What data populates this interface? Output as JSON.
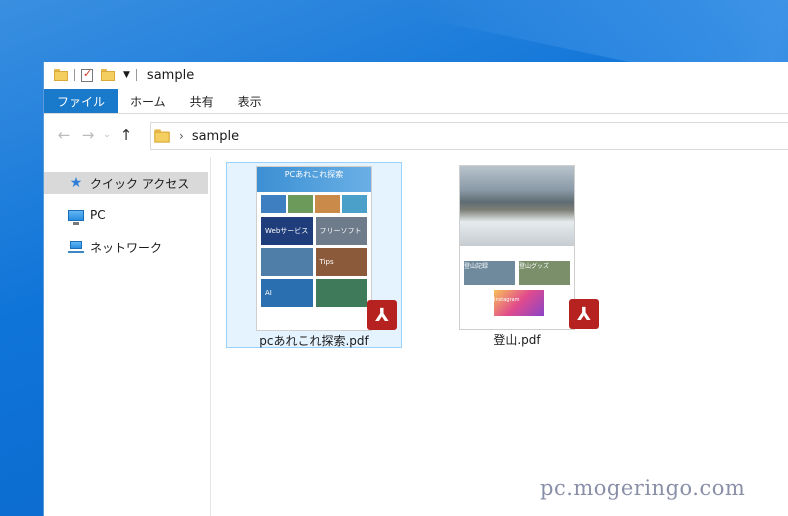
{
  "window": {
    "title": "sample"
  },
  "ribbon": {
    "tabs": [
      "ファイル",
      "ホーム",
      "共有",
      "表示"
    ]
  },
  "nav": {
    "back": "←",
    "forward": "→",
    "recent": "⌄",
    "up": "↑"
  },
  "address": {
    "chevron": "›",
    "path": "sample"
  },
  "sidebar": {
    "items": [
      {
        "label": "クイック アクセス",
        "icon": "star-icon"
      },
      {
        "label": "PC",
        "icon": "computer-icon"
      },
      {
        "label": "ネットワーク",
        "icon": "network-icon"
      }
    ]
  },
  "files": [
    {
      "name": "pcあれこれ探索.pdf",
      "thumb": {
        "head": "PCあれこれ探索",
        "cells": [
          "Webサービス",
          "フリーソフト",
          "",
          "Tips",
          "AI",
          ""
        ]
      }
    },
    {
      "name": "登山.pdf",
      "thumb": {
        "cells": [
          "登山記録",
          "登山グッズ"
        ],
        "insta": "Instagram"
      }
    }
  ],
  "watermark": "pc.mogeringo.com",
  "colors": {
    "accent": "#1979ca",
    "pdf": "#b5221f",
    "selection": "#e5f3ff"
  }
}
